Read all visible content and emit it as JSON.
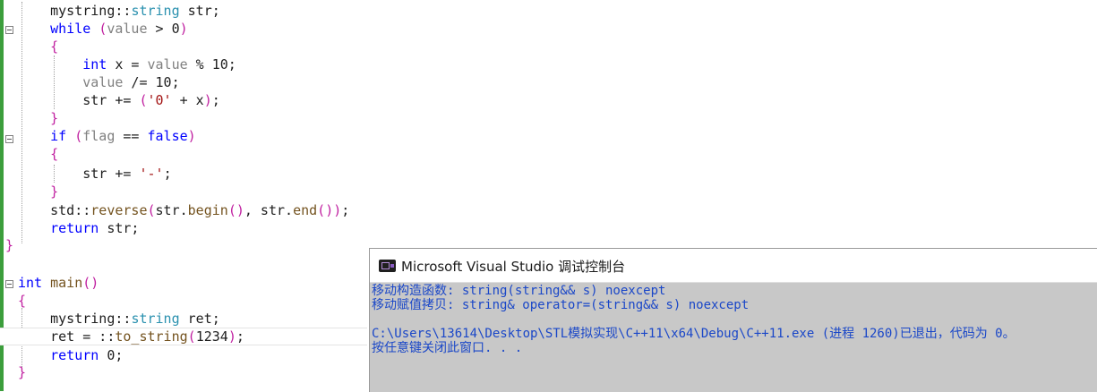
{
  "editor": {
    "lines": [
      {
        "id": "l1",
        "text": "    mystring::string str;"
      },
      {
        "id": "l2",
        "text": "    while (value > 0)"
      },
      {
        "id": "l3",
        "text": "    {"
      },
      {
        "id": "l4",
        "text": "        int x = value % 10;"
      },
      {
        "id": "l5",
        "text": "        value /= 10;"
      },
      {
        "id": "l6",
        "text": "        str += ('0' + x);"
      },
      {
        "id": "l7",
        "text": "    }"
      },
      {
        "id": "l8",
        "text": "    if (flag == false)"
      },
      {
        "id": "l9",
        "text": "    {"
      },
      {
        "id": "l10",
        "text": "        str += '-';"
      },
      {
        "id": "l11",
        "text": "    }"
      },
      {
        "id": "l12",
        "text": "    std::reverse(str.begin(), str.end());"
      },
      {
        "id": "l13",
        "text": "    return str;"
      },
      {
        "id": "l14",
        "text": "}"
      },
      {
        "id": "l15",
        "text": ""
      },
      {
        "id": "l16",
        "text": "int main()"
      },
      {
        "id": "l17",
        "text": "{"
      },
      {
        "id": "l18",
        "text": "    mystring::string ret;"
      },
      {
        "id": "l19",
        "text": "    ret = ::to_string(1234);"
      },
      {
        "id": "l20",
        "text": "    return 0;"
      },
      {
        "id": "l21",
        "text": "}"
      }
    ]
  },
  "console": {
    "title": "Microsoft Visual Studio 调试控制台",
    "lines": [
      "移动构造函数: string(string&& s) noexcept",
      "移动赋值拷贝: string& operator=(string&& s) noexcept",
      "",
      "C:\\Users\\13614\\Desktop\\STL模拟实现\\C++11\\x64\\Debug\\C++11.exe (进程 1260)已退出，代码为 0。",
      "按任意键关闭此窗口. . ."
    ]
  },
  "colors": {
    "keyword": "#0000ff",
    "type": "#2b91af",
    "string": "#a31515",
    "macro": "#8a1bb3",
    "console_text": "#1a47c8",
    "console_bg": "#c8c8c8",
    "change_bar": "#3c9e3c"
  }
}
